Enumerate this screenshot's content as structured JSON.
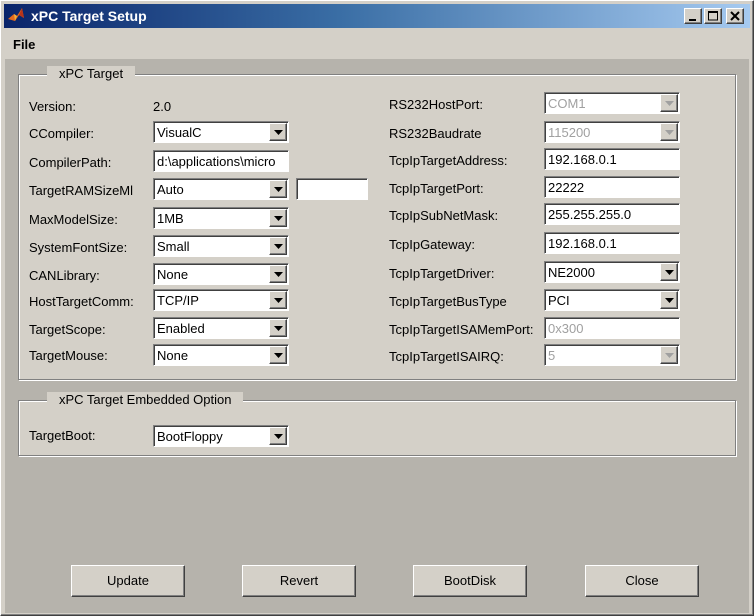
{
  "window": {
    "title": "xPC Target Setup"
  },
  "menu": {
    "file": "File"
  },
  "target_group": {
    "title": "xPC Target",
    "left": {
      "version_label": "Version:",
      "version_value": "2.0",
      "ccompiler_label": "CCompiler:",
      "ccompiler_value": "VisualC",
      "compilerpath_label": "CompilerPath:",
      "compilerpath_value": "d:\\applications\\micro",
      "targetram_label": "TargetRAMSizeMl",
      "targetram_value": "Auto",
      "targetram_size_value": "",
      "maxmodel_label": "MaxModelSize:",
      "maxmodel_value": "1MB",
      "sysfont_label": "SystemFontSize:",
      "sysfont_value": "Small",
      "canlib_label": "CANLibrary:",
      "canlib_value": "None",
      "hostcomm_label": "HostTargetComm:",
      "hostcomm_value": "TCP/IP",
      "scope_label": "TargetScope:",
      "scope_value": "Enabled",
      "mouse_label": "TargetMouse:",
      "mouse_value": "None"
    },
    "right": {
      "hostport_label": "RS232HostPort:",
      "hostport_value": "COM1",
      "baud_label": "RS232Baudrate",
      "baud_value": "115200",
      "ipaddr_label": "TcpIpTargetAddress:",
      "ipaddr_value": "192.168.0.1",
      "ipport_label": "TcpIpTargetPort:",
      "ipport_value": "22222",
      "subnet_label": "TcpIpSubNetMask:",
      "subnet_value": "255.255.255.0",
      "gateway_label": "TcpIpGateway:",
      "gateway_value": "192.168.0.1",
      "driver_label": "TcpIpTargetDriver:",
      "driver_value": "NE2000",
      "bustype_label": "TcpIpTargetBusType",
      "bustype_value": "PCI",
      "isamem_label": "TcpIpTargetISAMemPort:",
      "isamem_value": "0x300",
      "isairq_label": "TcpIpTargetISAIRQ:",
      "isairq_value": "5"
    }
  },
  "embedded_group": {
    "title": "xPC Target Embedded Option",
    "targetboot_label": "TargetBoot:",
    "targetboot_value": "BootFloppy"
  },
  "buttons": {
    "update": "Update",
    "revert": "Revert",
    "bootdisk": "BootDisk",
    "close": "Close"
  },
  "colors": {
    "title_gradient_start": "#0a246a",
    "title_gradient_end": "#a6caf0",
    "window_face": "#d4d0c8",
    "content_background": "#b6b3ac",
    "disabled_text": "#a0a0a0"
  },
  "icons": {
    "app": "matlab-icon",
    "minimize": "minimize-icon",
    "maximize": "maximize-icon",
    "close": "close-icon",
    "dropdown": "chevron-down-icon"
  }
}
